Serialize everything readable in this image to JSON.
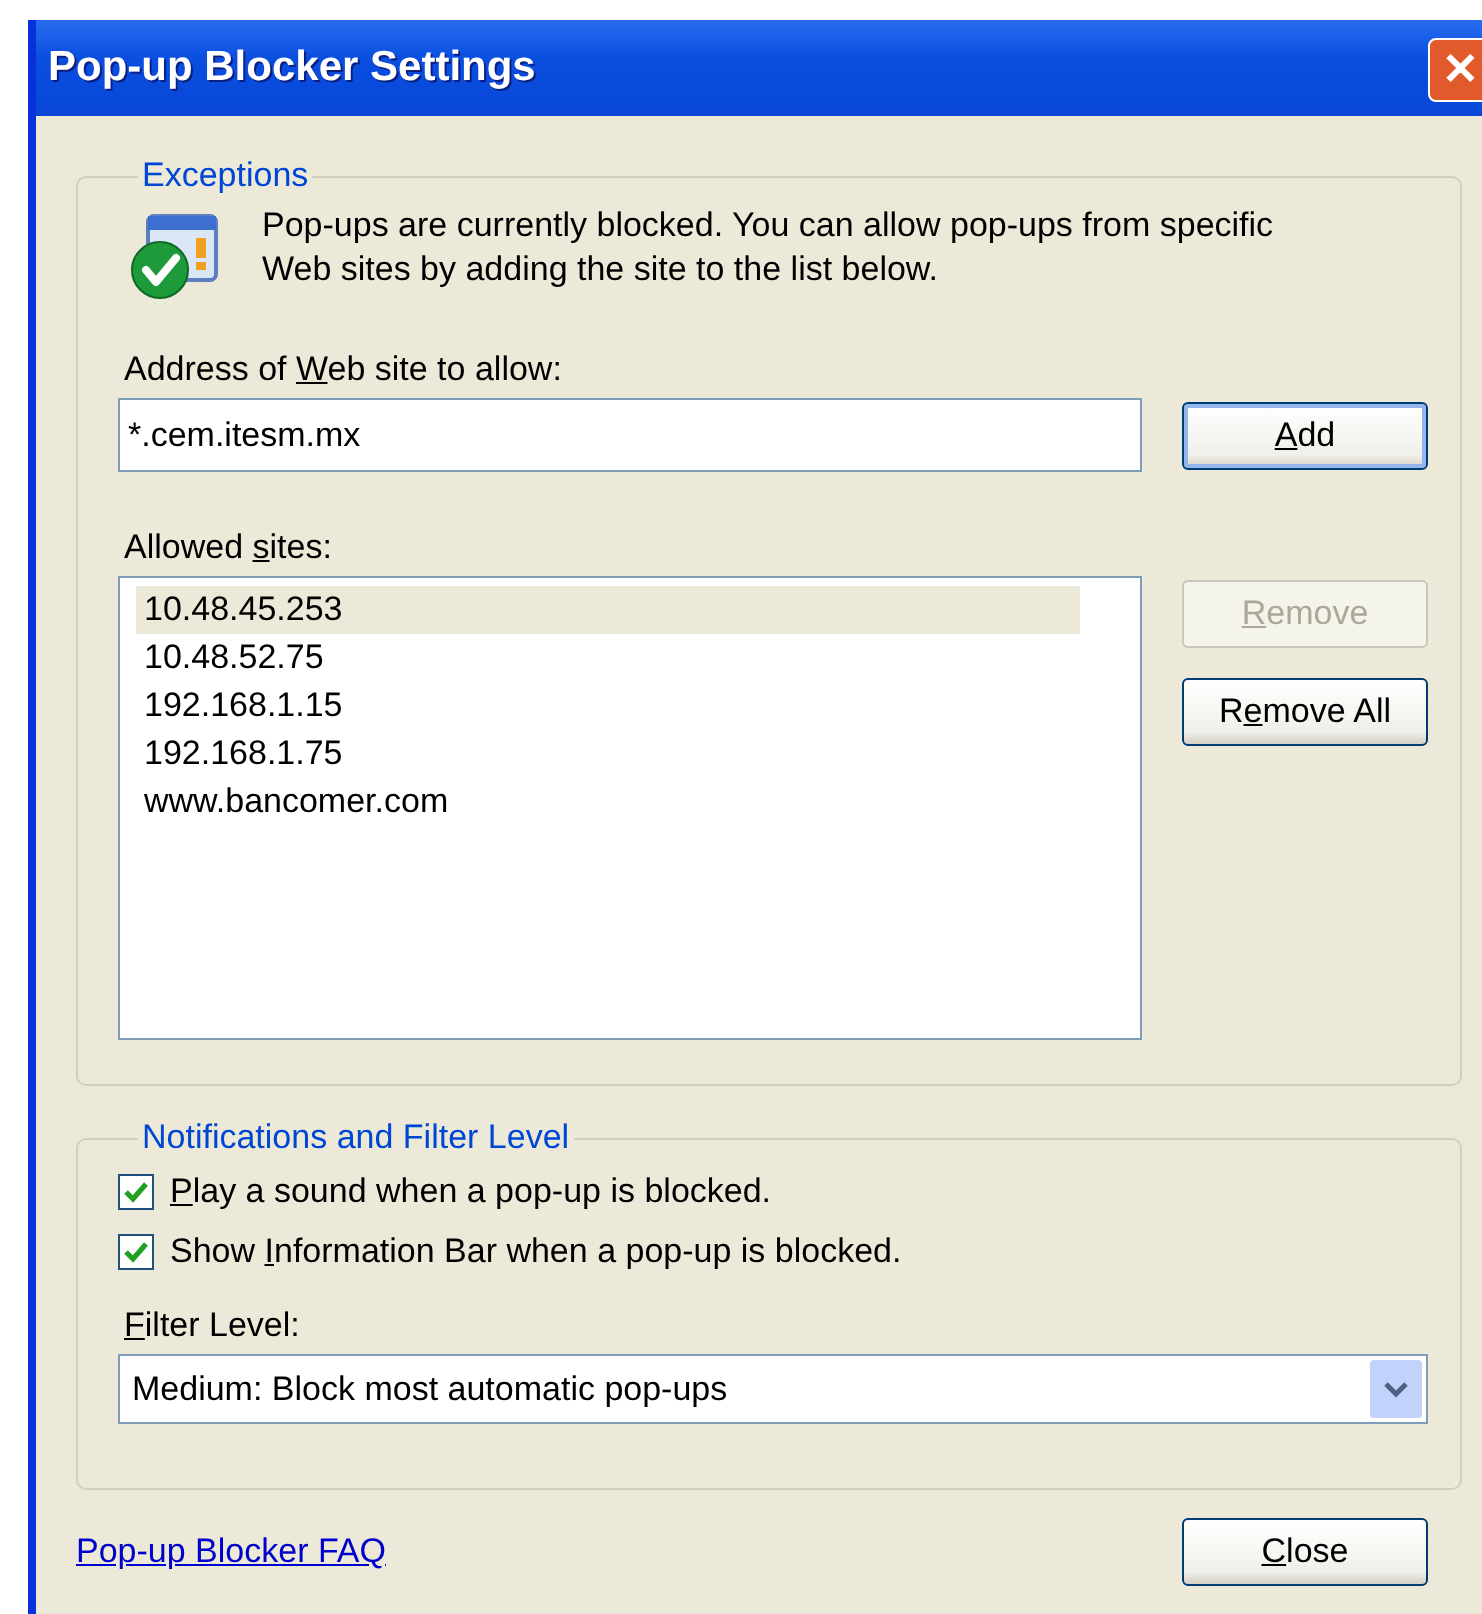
{
  "window": {
    "title": "Pop-up Blocker Settings",
    "close": "✕"
  },
  "exceptions": {
    "legend": "Exceptions",
    "message": "Pop-ups are currently blocked.  You can allow pop-ups from specific Web sites by adding the site to the list below.",
    "address_label": {
      "before": "Address of ",
      "key": "W",
      "after": "eb site to allow:"
    },
    "address_value": "*.cem.itesm.mx",
    "add_button": {
      "key": "A",
      "after": "dd",
      "disabled": false
    },
    "sites_label": {
      "before": "Allowed ",
      "key": "s",
      "after": "ites:"
    },
    "sites": [
      {
        "text": "10.48.45.253",
        "selected": true
      },
      {
        "text": "10.48.52.75",
        "selected": false
      },
      {
        "text": "192.168.1.15",
        "selected": false
      },
      {
        "text": "192.168.1.75",
        "selected": false
      },
      {
        "text": "www.bancomer.com",
        "selected": false
      }
    ],
    "side_buttons": [
      {
        "key": "R",
        "after": "emove",
        "disabled": true
      },
      {
        "before": "R",
        "key": "e",
        "after": "move All",
        "disabled": false
      }
    ]
  },
  "notifications": {
    "legend": "Notifications and Filter Level",
    "options": [
      {
        "key": "P",
        "after": "lay a sound when a pop-up is blocked.",
        "checked": true
      },
      {
        "before": "Show ",
        "key": "I",
        "after": "nformation Bar when a pop-up is blocked.",
        "checked": true
      }
    ],
    "filter_label": {
      "key": "F",
      "after": "ilter Level:"
    },
    "filter_value": "Medium: Block most automatic pop-ups"
  },
  "faq_link": "Pop-up Blocker FAQ",
  "close_button": {
    "key": "C",
    "after": "lose",
    "disabled": false
  }
}
